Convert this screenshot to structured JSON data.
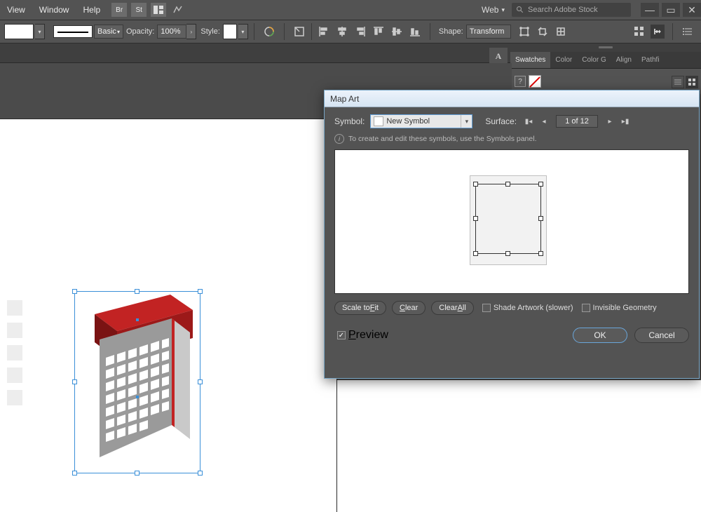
{
  "menubar": {
    "items": [
      "View",
      "Window",
      "Help"
    ],
    "badges": [
      "Br",
      "St"
    ],
    "workspace": "Web",
    "search_placeholder": "Search Adobe Stock"
  },
  "ctrlbar": {
    "stroke_style": "Basic",
    "opacity_label": "Opacity:",
    "opacity_value": "100%",
    "style_label": "Style:",
    "shape_label": "Shape:",
    "transform_label": "Transform"
  },
  "panels": {
    "tabs": [
      "Swatches",
      "Color",
      "Color Guide",
      "Align",
      "Pathfinder"
    ],
    "active_tab": 0,
    "float_items": [
      "A",
      "¶"
    ],
    "tooltip": "?"
  },
  "dialog": {
    "title": "Map Art",
    "symbol_label": "Symbol:",
    "symbol_value": "New Symbol",
    "surface_label": "Surface:",
    "surface_pos": "1 of 12",
    "info_text": "To create and edit these symbols, use the Symbols panel.",
    "scale_btn_pre": "Scale to ",
    "scale_btn_u": "F",
    "scale_btn_post": "it",
    "clear_btn_u": "C",
    "clear_btn_post": "lear",
    "clearall_btn_pre": "Clear ",
    "clearall_btn_u": "A",
    "clearall_btn_post": "ll",
    "shade_label": "Shade Artwork (slower)",
    "invisible_label": "Invisible Geometry",
    "preview_u": "P",
    "preview_post": "review",
    "ok_label": "OK",
    "cancel_label": "Cancel"
  },
  "colors": {
    "accent": "#3a8fd8",
    "panel": "#535353",
    "red": "#c22323"
  }
}
